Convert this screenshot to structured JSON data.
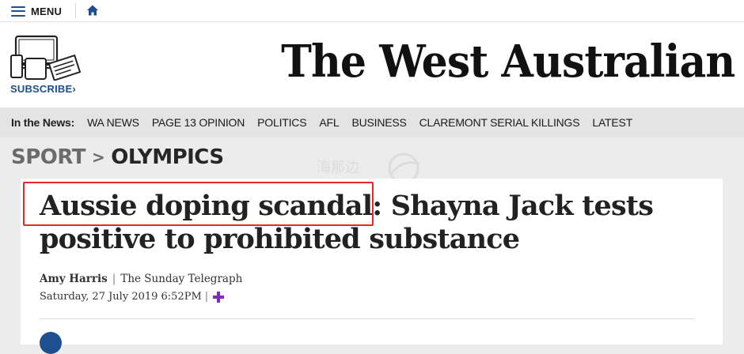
{
  "topbar": {
    "menu_label": "MENU"
  },
  "masthead": {
    "subscribe_label": "SUBSCRIBE",
    "logo_text": "The West Australian"
  },
  "nav": {
    "lead": "In the News:",
    "items": [
      "WA NEWS",
      "PAGE 13 OPINION",
      "POLITICS",
      "AFL",
      "BUSINESS",
      "CLAREMONT SERIAL KILLINGS",
      "LATEST"
    ]
  },
  "breadcrumb": {
    "section": "SPORT",
    "separator": ">",
    "subsection": "OLYMPICS"
  },
  "article": {
    "headline_part1": "Aussie doping scandal:",
    "headline_part2": " Shayna Jack tests positive to prohibited substance",
    "author": "Amy Harris",
    "publication": "The Sunday Telegraph",
    "date": "Saturday, 27 July 2019 6:52PM"
  },
  "watermark": {
    "text": "海那边"
  },
  "colors": {
    "brand_blue": "#1d4f91",
    "highlight_red": "#e12b2b",
    "plus_purple": "#7b2cbf"
  }
}
